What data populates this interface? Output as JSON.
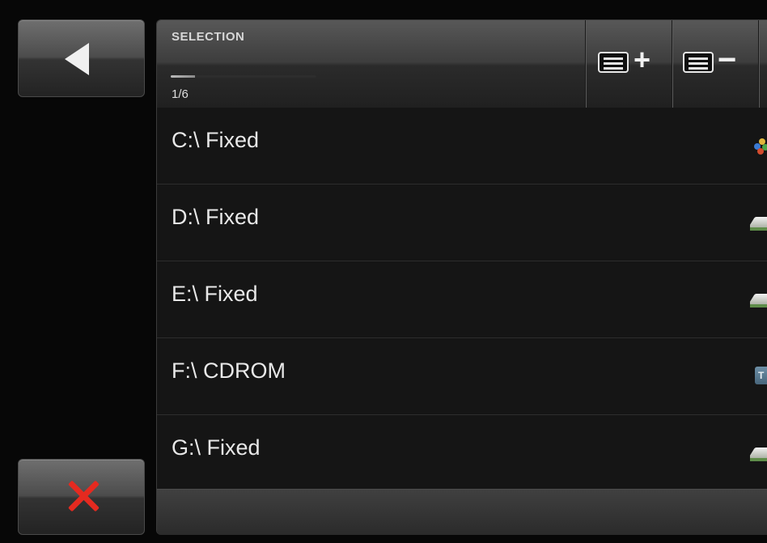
{
  "navigation": {
    "back_icon": "left-triangle-icon",
    "close_icon": "red-x-icon"
  },
  "header": {
    "selection_label": "SELECTION",
    "page_counter": "1/6",
    "progress": 0.1667,
    "add_icon": "list-plus-icon",
    "remove_icon": "list-minus-icon",
    "plus_text": "+",
    "minus_text": "−"
  },
  "drives": [
    {
      "label": "C:\\ Fixed",
      "icon": "network-drive-icon"
    },
    {
      "label": "D:\\ Fixed",
      "icon": "hard-drive-icon"
    },
    {
      "label": "E:\\ Fixed",
      "icon": "hard-drive-icon"
    },
    {
      "label": "F:\\ CDROM",
      "icon": "cd-rom-icon",
      "icon_text": "T"
    },
    {
      "label": "G:\\ Fixed",
      "icon": "hard-drive-icon"
    }
  ],
  "colors": {
    "background": "#070707",
    "row_background": "#151515",
    "text": "#e8e8e8",
    "close_red": "#e52a20"
  }
}
